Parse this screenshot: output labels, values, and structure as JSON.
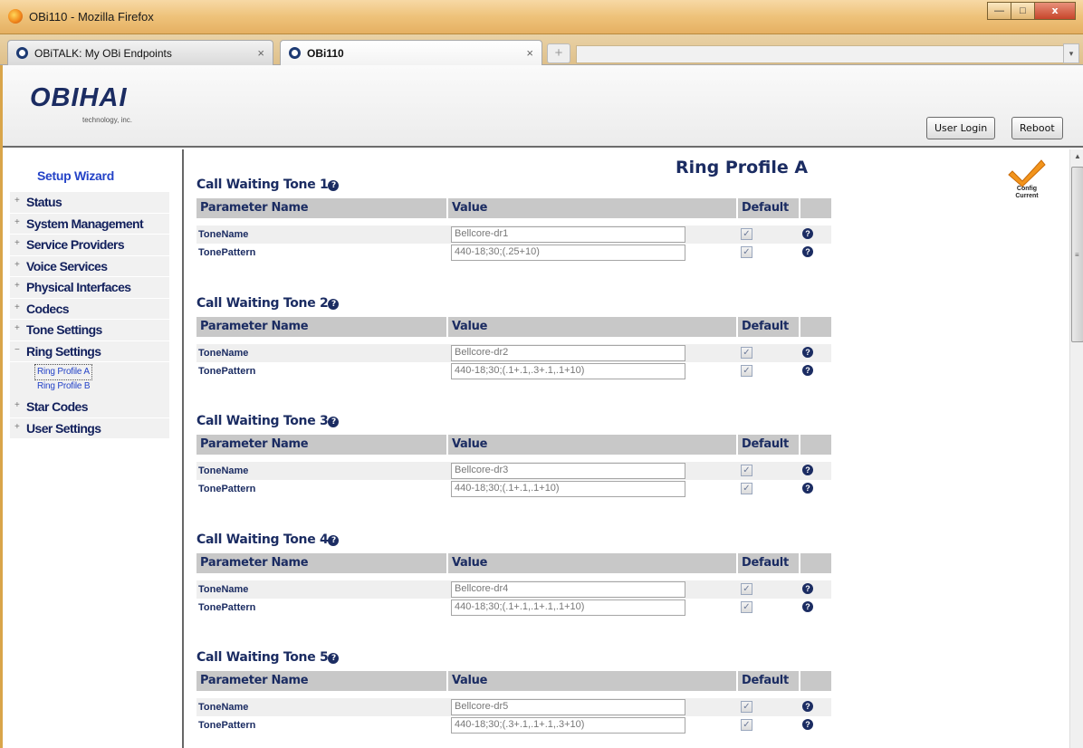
{
  "window": {
    "title": "OBi110 - Mozilla Firefox",
    "minimize": "—",
    "maximize": "□",
    "close": "x"
  },
  "tabs": [
    {
      "label": "OBiTALK: My OBi Endpoints",
      "close": "×"
    },
    {
      "label": "OBi110",
      "close": "×"
    }
  ],
  "newtab": "+",
  "tablist": "▾",
  "header": {
    "logo": "OBIHAI",
    "logo_sub": "technology, inc.",
    "user_login": "User Login",
    "reboot": "Reboot"
  },
  "sidebar": {
    "setup_wizard": "Setup Wizard",
    "items": [
      {
        "sign": "+",
        "label": "Status"
      },
      {
        "sign": "+",
        "label": "System Management"
      },
      {
        "sign": "+",
        "label": "Service Providers"
      },
      {
        "sign": "+",
        "label": "Voice Services"
      },
      {
        "sign": "+",
        "label": "Physical Interfaces"
      },
      {
        "sign": "+",
        "label": "Codecs"
      },
      {
        "sign": "+",
        "label": "Tone Settings"
      },
      {
        "sign": "−",
        "label": "Ring Settings"
      },
      {
        "sign": "+",
        "label": "Star Codes"
      },
      {
        "sign": "+",
        "label": "User Settings"
      }
    ],
    "ring_sub": [
      "Ring Profile A",
      "Ring Profile B"
    ]
  },
  "main": {
    "title": "Ring Profile A",
    "config_status": [
      "Config",
      "Current"
    ],
    "columns": {
      "name": "Parameter Name",
      "value": "Value",
      "default": "Default"
    },
    "help": "?",
    "check": "✓",
    "sections": [
      {
        "title": "Call Waiting Tone 1",
        "rows": [
          {
            "name": "ToneName",
            "value": "Bellcore-dr1"
          },
          {
            "name": "TonePattern",
            "value": "440-18;30;(.25+10)"
          }
        ]
      },
      {
        "title": "Call Waiting Tone 2",
        "rows": [
          {
            "name": "ToneName",
            "value": "Bellcore-dr2"
          },
          {
            "name": "TonePattern",
            "value": "440-18;30;(.1+.1,.3+.1,.1+10)"
          }
        ]
      },
      {
        "title": "Call Waiting Tone 3",
        "rows": [
          {
            "name": "ToneName",
            "value": "Bellcore-dr3"
          },
          {
            "name": "TonePattern",
            "value": "440-18;30;(.1+.1,.1+10)"
          }
        ]
      },
      {
        "title": "Call Waiting Tone 4",
        "rows": [
          {
            "name": "ToneName",
            "value": "Bellcore-dr4"
          },
          {
            "name": "TonePattern",
            "value": "440-18;30;(.1+.1,.1+.1,.1+10)"
          }
        ]
      },
      {
        "title": "Call Waiting Tone 5",
        "rows": [
          {
            "name": "ToneName",
            "value": "Bellcore-dr5"
          },
          {
            "name": "TonePattern",
            "value": "440-18;30;(.3+.1,.1+.1,.3+10)"
          }
        ]
      }
    ]
  },
  "colors": {
    "accent_navy": "#1b2c62",
    "link_blue": "#2443c7",
    "header_gray": "#c8c8c8",
    "check_orange": "#f2941c"
  }
}
